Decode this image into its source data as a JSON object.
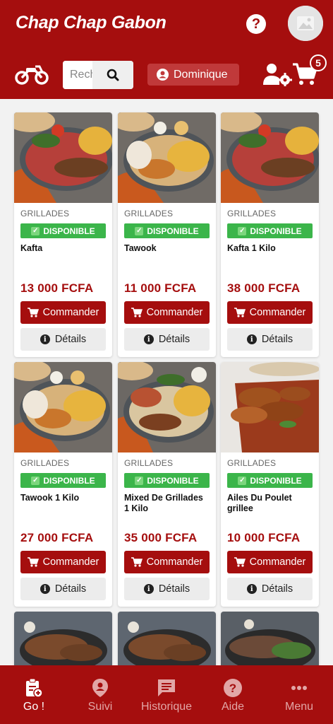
{
  "header": {
    "title": "Chap Chap Gabon",
    "help_label": "?",
    "search_placeholder": "Recherche",
    "user_name": "Dominique",
    "cart_count": "5"
  },
  "products": [
    {
      "category": "GRILLADES",
      "status": "DISPONIBLE",
      "name": "Kafta",
      "price": "13 000 FCFA",
      "order_label": "Commander",
      "details_label": "Détails"
    },
    {
      "category": "GRILLADES",
      "status": "DISPONIBLE",
      "name": "Tawook",
      "price": "11 000 FCFA",
      "order_label": "Commander",
      "details_label": "Détails"
    },
    {
      "category": "GRILLADES",
      "status": "DISPONIBLE",
      "name": "Kafta 1 Kilo",
      "price": "38 000 FCFA",
      "order_label": "Commander",
      "details_label": "Détails"
    },
    {
      "category": "GRILLADES",
      "status": "DISPONIBLE",
      "name": "Tawook 1 Kilo",
      "price": "27 000 FCFA",
      "order_label": "Commander",
      "details_label": "Détails"
    },
    {
      "category": "GRILLADES",
      "status": "DISPONIBLE",
      "name": "Mixed De Grillades 1 Kilo",
      "price": "35 000 FCFA",
      "order_label": "Commander",
      "details_label": "Détails"
    },
    {
      "category": "GRILLADES",
      "status": "DISPONIBLE",
      "name": "Ailes Du Poulet grillee",
      "price": "10 000 FCFA",
      "order_label": "Commander",
      "details_label": "Détails"
    }
  ],
  "nav": {
    "go": "Go !",
    "suivi": "Suivi",
    "historique": "Historique",
    "aide": "Aide",
    "menu": "Menu"
  },
  "colors": {
    "brand": "#a50e0e",
    "available": "#3bb54a"
  }
}
